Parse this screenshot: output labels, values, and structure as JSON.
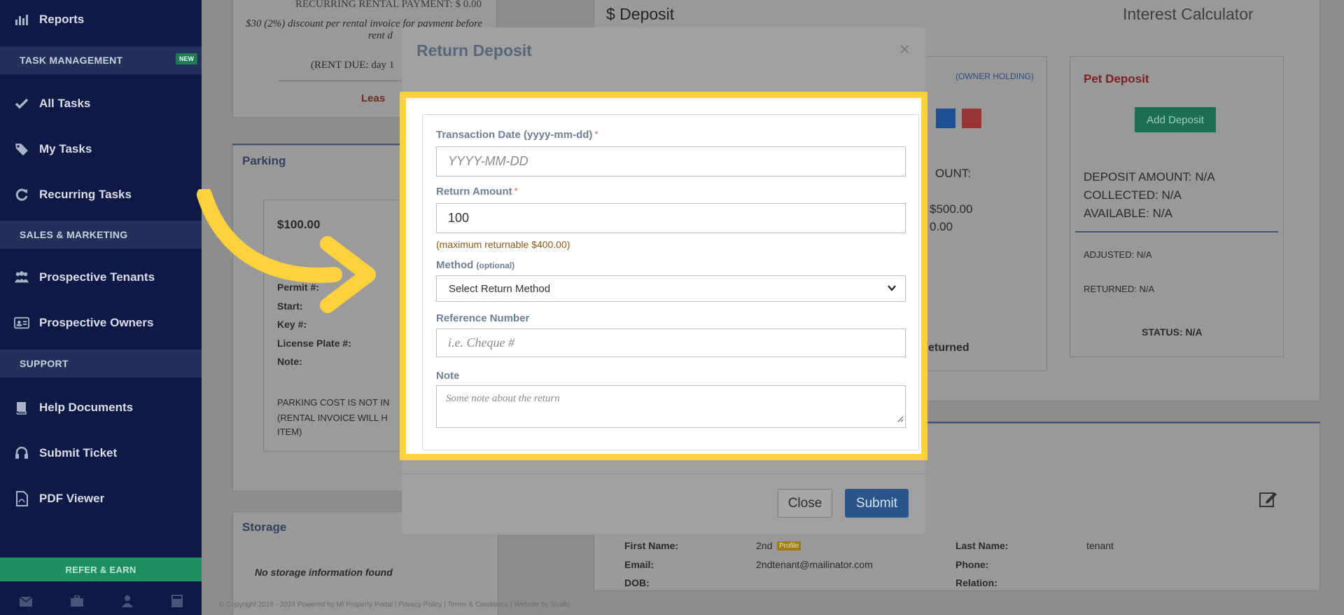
{
  "sidebar": {
    "reports": "Reports",
    "task_management": "TASK MANAGEMENT",
    "new_badge": "NEW",
    "all_tasks": "All Tasks",
    "my_tasks": "My Tasks",
    "recurring_tasks": "Recurring Tasks",
    "sales_marketing": "SALES & MARKETING",
    "prospective_tenants": "Prospective Tenants",
    "prospective_owners": "Prospective Owners",
    "support": "SUPPORT",
    "help_documents": "Help Documents",
    "submit_ticket": "Submit Ticket",
    "pdf_viewer": "PDF Viewer",
    "refer_earn": "REFER & EARN"
  },
  "background": {
    "recurring_payment": "RECURRING RENTAL PAYMENT: $ 0.00",
    "discount_line1": "$30 (2%) discount per rental invoice for payment before",
    "discount_line2": "rent d",
    "rent_due": "(RENT DUE: day 1",
    "lease": "Leas",
    "parking_title": "Parking",
    "parking_amount": "$100.00",
    "permit": "Permit #:",
    "start": "Start:",
    "key": "Key #:",
    "license_plate": "License Plate #:",
    "note": "Note:",
    "parking_cost_1": "PARKING COST IS NOT IN",
    "parking_cost_2": "(RENTAL INVOICE WILL H",
    "parking_cost_3": "ITEM)",
    "storage_title": "Storage",
    "no_storage": "No storage information found",
    "deposit_title": "$ Deposit",
    "interest_calculator": "Interest Calculator",
    "owner_holding": "(OWNER HOLDING)",
    "ount": "OUNT:",
    "amount_500": "$500.00",
    "amount_0": "0.00",
    "returned": "eturned",
    "pet_deposit": "Pet Deposit",
    "add_deposit": "Add Deposit",
    "deposit_amount": "DEPOSIT AMOUNT: N/A",
    "collected": "COLLECTED: N/A",
    "available": "AVAILABLE: N/A",
    "adjusted": "ADJUSTED: N/A",
    "returned_na": "RETURNED: N/A",
    "status": "STATUS: N/A",
    "first_name_label": "First Name:",
    "first_name_value": "2nd",
    "profile_badge": "Profile",
    "last_name_label": "Last Name:",
    "last_name_value": "tenant",
    "email_label": "Email:",
    "email_value": "2ndtenant@mailinator.com",
    "phone_label": "Phone:",
    "dob_label": "DOB:",
    "relation_label": "Relation:",
    "copyright": "© Copyright 2016 - 2024 Powered by MI Property Portal | Privacy Policy | Terms & Conditions | Website by Studio"
  },
  "modal": {
    "title": "Return Deposit",
    "close_x": "×",
    "transaction_date_label": "Transaction Date (yyyy-mm-dd)",
    "transaction_date_placeholder": "YYYY-MM-DD",
    "return_amount_label": "Return Amount",
    "return_amount_value": "100",
    "max_returnable": "(maximum returnable $400.00)",
    "method_label": "Method",
    "method_optional": "(optional)",
    "method_selected": "Select Return Method",
    "reference_label": "Reference Number",
    "reference_placeholder": "i.e. Cheque #",
    "note_label": "Note",
    "note_placeholder": "Some note about the return",
    "required_mark": "*",
    "close_button": "Close",
    "submit_button": "Submit"
  },
  "colors": {
    "sidebar_bg": "#0e1945",
    "highlight": "#fbd13c",
    "submit_bg": "#2b5588",
    "refer_bg": "#1e8f61"
  }
}
